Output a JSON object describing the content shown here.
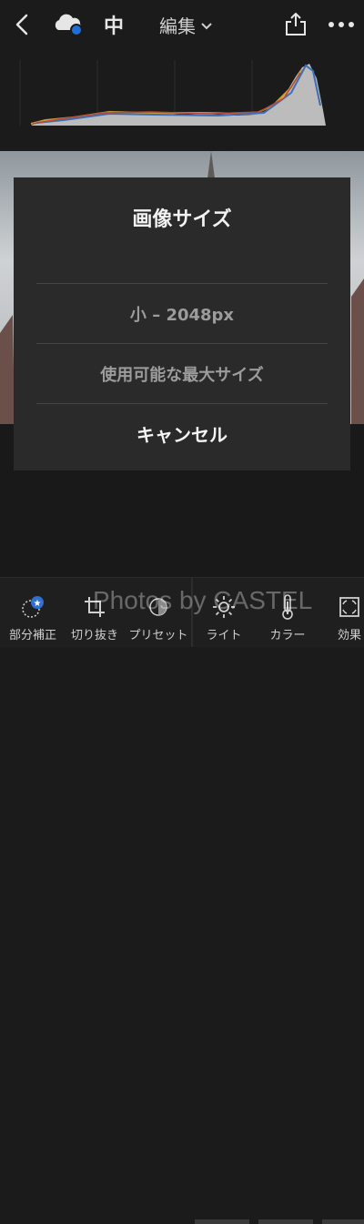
{
  "header": {
    "quality_label": "中",
    "edit_label": "編集",
    "icons": [
      "back-chevron-icon",
      "cloud-sync-icon",
      "share-icon",
      "more-icon"
    ],
    "cloud_dot_color": "#1f6fd6"
  },
  "dialog": {
    "title": "画像サイズ",
    "options": [
      "小 – 2048px",
      "使用可能な最大サイズ"
    ],
    "cancel_label": "キャンセル"
  },
  "toolbar": {
    "tools": [
      {
        "label": "部分補正",
        "icon": "local-adjust-icon"
      },
      {
        "label": "切り抜き",
        "icon": "crop-icon"
      },
      {
        "label": "プリセット",
        "icon": "presets-icon"
      },
      {
        "label": "ライト",
        "icon": "light-icon"
      },
      {
        "label": "カラー",
        "icon": "thermometer-icon"
      },
      {
        "label": "効果",
        "icon": "effects-icon"
      }
    ]
  },
  "watermark": "Photos by CASTEL"
}
